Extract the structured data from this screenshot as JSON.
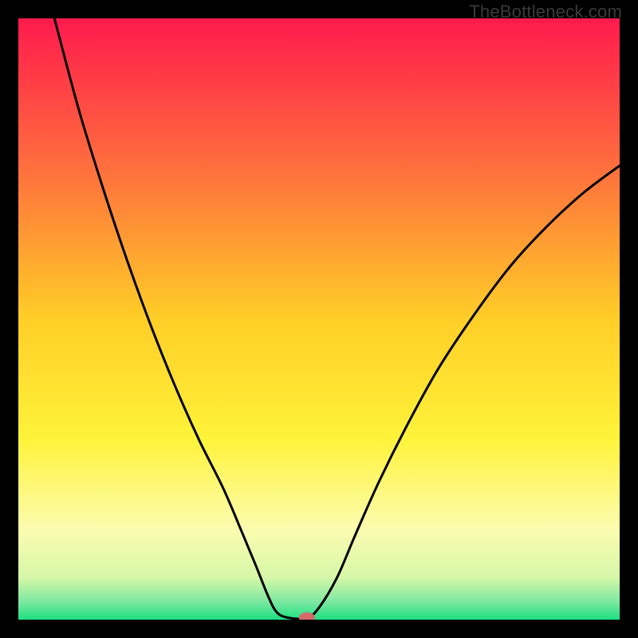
{
  "attribution": "TheBottleneck.com",
  "chart_data": {
    "type": "line",
    "title": "",
    "xlabel": "",
    "ylabel": "",
    "xlim": [
      0,
      100
    ],
    "ylim": [
      0,
      100
    ],
    "grid": false,
    "legend": false,
    "background_gradient": {
      "stops": [
        {
          "pos": 0.0,
          "color": "#ff1a4d"
        },
        {
          "pos": 0.25,
          "color": "#ff6f3d"
        },
        {
          "pos": 0.5,
          "color": "#ffce27"
        },
        {
          "pos": 0.7,
          "color": "#fff33a"
        },
        {
          "pos": 0.85,
          "color": "#fcfcb0"
        },
        {
          "pos": 0.93,
          "color": "#d6f7a8"
        },
        {
          "pos": 0.97,
          "color": "#7de8a0"
        },
        {
          "pos": 1.0,
          "color": "#1de082"
        }
      ]
    },
    "series": [
      {
        "name": "curve",
        "type": "line",
        "color": "#000000",
        "points": [
          {
            "x": 6.0,
            "y": 100.0
          },
          {
            "x": 10.0,
            "y": 85.0
          },
          {
            "x": 14.0,
            "y": 72.0
          },
          {
            "x": 18.0,
            "y": 60.0
          },
          {
            "x": 22.0,
            "y": 49.0
          },
          {
            "x": 26.0,
            "y": 39.0
          },
          {
            "x": 30.0,
            "y": 30.0
          },
          {
            "x": 34.0,
            "y": 22.0
          },
          {
            "x": 37.0,
            "y": 15.0
          },
          {
            "x": 39.5,
            "y": 9.0
          },
          {
            "x": 41.5,
            "y": 4.0
          },
          {
            "x": 43.0,
            "y": 1.2
          },
          {
            "x": 45.0,
            "y": 0.3
          },
          {
            "x": 48.0,
            "y": 0.3
          },
          {
            "x": 50.0,
            "y": 2.0
          },
          {
            "x": 53.0,
            "y": 7.0
          },
          {
            "x": 56.0,
            "y": 14.0
          },
          {
            "x": 60.0,
            "y": 23.0
          },
          {
            "x": 65.0,
            "y": 33.0
          },
          {
            "x": 70.0,
            "y": 42.0
          },
          {
            "x": 76.0,
            "y": 51.0
          },
          {
            "x": 82.0,
            "y": 59.0
          },
          {
            "x": 88.0,
            "y": 65.5
          },
          {
            "x": 94.0,
            "y": 71.0
          },
          {
            "x": 100.0,
            "y": 75.5
          }
        ]
      },
      {
        "name": "optimum-marker",
        "type": "scatter",
        "color": "#d46a6a",
        "points": [
          {
            "x": 48.0,
            "y": 0.3
          }
        ]
      }
    ]
  }
}
